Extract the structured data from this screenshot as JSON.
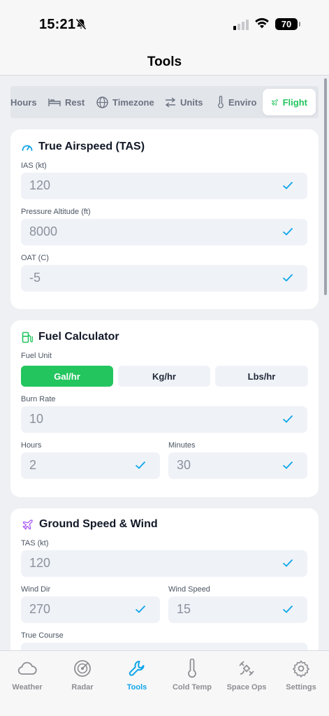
{
  "status_bar": {
    "time": "15:21",
    "battery": "70"
  },
  "header": {
    "title": "Tools"
  },
  "tabs": [
    {
      "label": "Hours",
      "icon": "clock-icon"
    },
    {
      "label": "Rest",
      "icon": "bed-icon"
    },
    {
      "label": "Timezone",
      "icon": "globe-icon"
    },
    {
      "label": "Units",
      "icon": "swap-arrows-icon"
    },
    {
      "label": "Enviro",
      "icon": "thermometer-icon"
    },
    {
      "label": "Flight",
      "icon": "plane-icon",
      "active": true
    }
  ],
  "tas_card": {
    "title": "True Airspeed (TAS)",
    "ias_label": "IAS (kt)",
    "ias_value": "120",
    "alt_label": "Pressure Altitude (ft)",
    "alt_value": "8000",
    "oat_label": "OAT (C)",
    "oat_value": "-5"
  },
  "fuel_card": {
    "title": "Fuel Calculator",
    "unit_label": "Fuel Unit",
    "units": [
      "Gal/hr",
      "Kg/hr",
      "Lbs/hr"
    ],
    "selected_unit": "Gal/hr",
    "burn_label": "Burn Rate",
    "burn_value": "10",
    "hours_label": "Hours",
    "hours_value": "2",
    "minutes_label": "Minutes",
    "minutes_value": "30"
  },
  "wind_card": {
    "title": "Ground Speed & Wind",
    "tas_label": "TAS (kt)",
    "tas_value": "120",
    "dir_label": "Wind Dir",
    "dir_value": "270",
    "speed_label": "Wind Speed",
    "speed_value": "15",
    "course_label": "True Course"
  },
  "tabbar": [
    {
      "label": "Weather",
      "icon": "cloud-icon"
    },
    {
      "label": "Radar",
      "icon": "radar-icon"
    },
    {
      "label": "Tools",
      "icon": "wrench-icon",
      "active": true
    },
    {
      "label": "Cold Temp",
      "icon": "thermometer-icon"
    },
    {
      "label": "Space Ops",
      "icon": "satellite-icon"
    },
    {
      "label": "Settings",
      "icon": "gear-icon"
    }
  ],
  "colors": {
    "accent_green": "#22c55e",
    "accent_blue": "#0ea5e9",
    "accent_purple": "#a855f7",
    "check_blue": "#0ea5e9"
  }
}
